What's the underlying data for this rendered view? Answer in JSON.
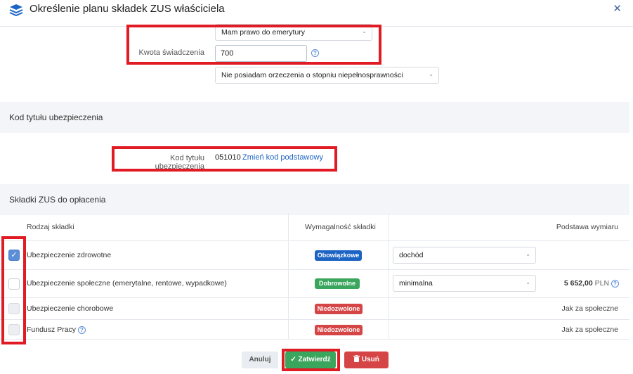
{
  "header": {
    "title": "Określenie planu składek ZUS właściciela",
    "logo_icon": "layers-icon",
    "close_symbol": "✕"
  },
  "pension": {
    "status_select": "Mam prawo do emerytury",
    "amount_label": "Kwota świadczenia",
    "amount_value": "700",
    "disability_select": "Nie posiadam orzeczenia o stopniu niepełnosprawności"
  },
  "insurance_code": {
    "section_title": "Kod tytułu ubezpieczenia",
    "label": "Kod tytułu ubezpieczenia",
    "code": "051010",
    "change_link": "Zmień kod podstawowy"
  },
  "contributions": {
    "section_title": "Składki ZUS do opłacenia",
    "columns": {
      "type": "Rodzaj składki",
      "requirement": "Wymagalność składki",
      "base": "Podstawa wymiaru"
    },
    "rows": [
      {
        "name": "Ubezpieczenie zdrowotne",
        "checked": true,
        "badge": "Obowiązkowe",
        "badge_color": "#1c64c4",
        "select": "dochód",
        "base": ""
      },
      {
        "name": "Ubezpieczenie społeczne (emerytalne, rentowe, wypadkowe)",
        "checked": false,
        "badge": "Dobrowolne",
        "badge_color": "#3aa55c",
        "select": "minimalna",
        "base_amount": "5 652,00",
        "base_currency": "PLN"
      },
      {
        "name": "Ubezpieczenie chorobowe",
        "checked": false,
        "badge": "Niedozwolone",
        "badge_color": "#d64545",
        "base": "Jak za społeczne"
      },
      {
        "name": "Fundusz Pracy",
        "checked": false,
        "badge": "Niedozwolone",
        "badge_color": "#d64545",
        "base": "Jak za społeczne"
      }
    ]
  },
  "footer": {
    "cancel": "Anuluj",
    "confirm": "Zatwierdź",
    "delete": "Usuń"
  },
  "colors": {
    "highlight": "#e01b24",
    "primary": "#5b8ed6",
    "confirm": "#3aa55c",
    "delete": "#d64545"
  }
}
